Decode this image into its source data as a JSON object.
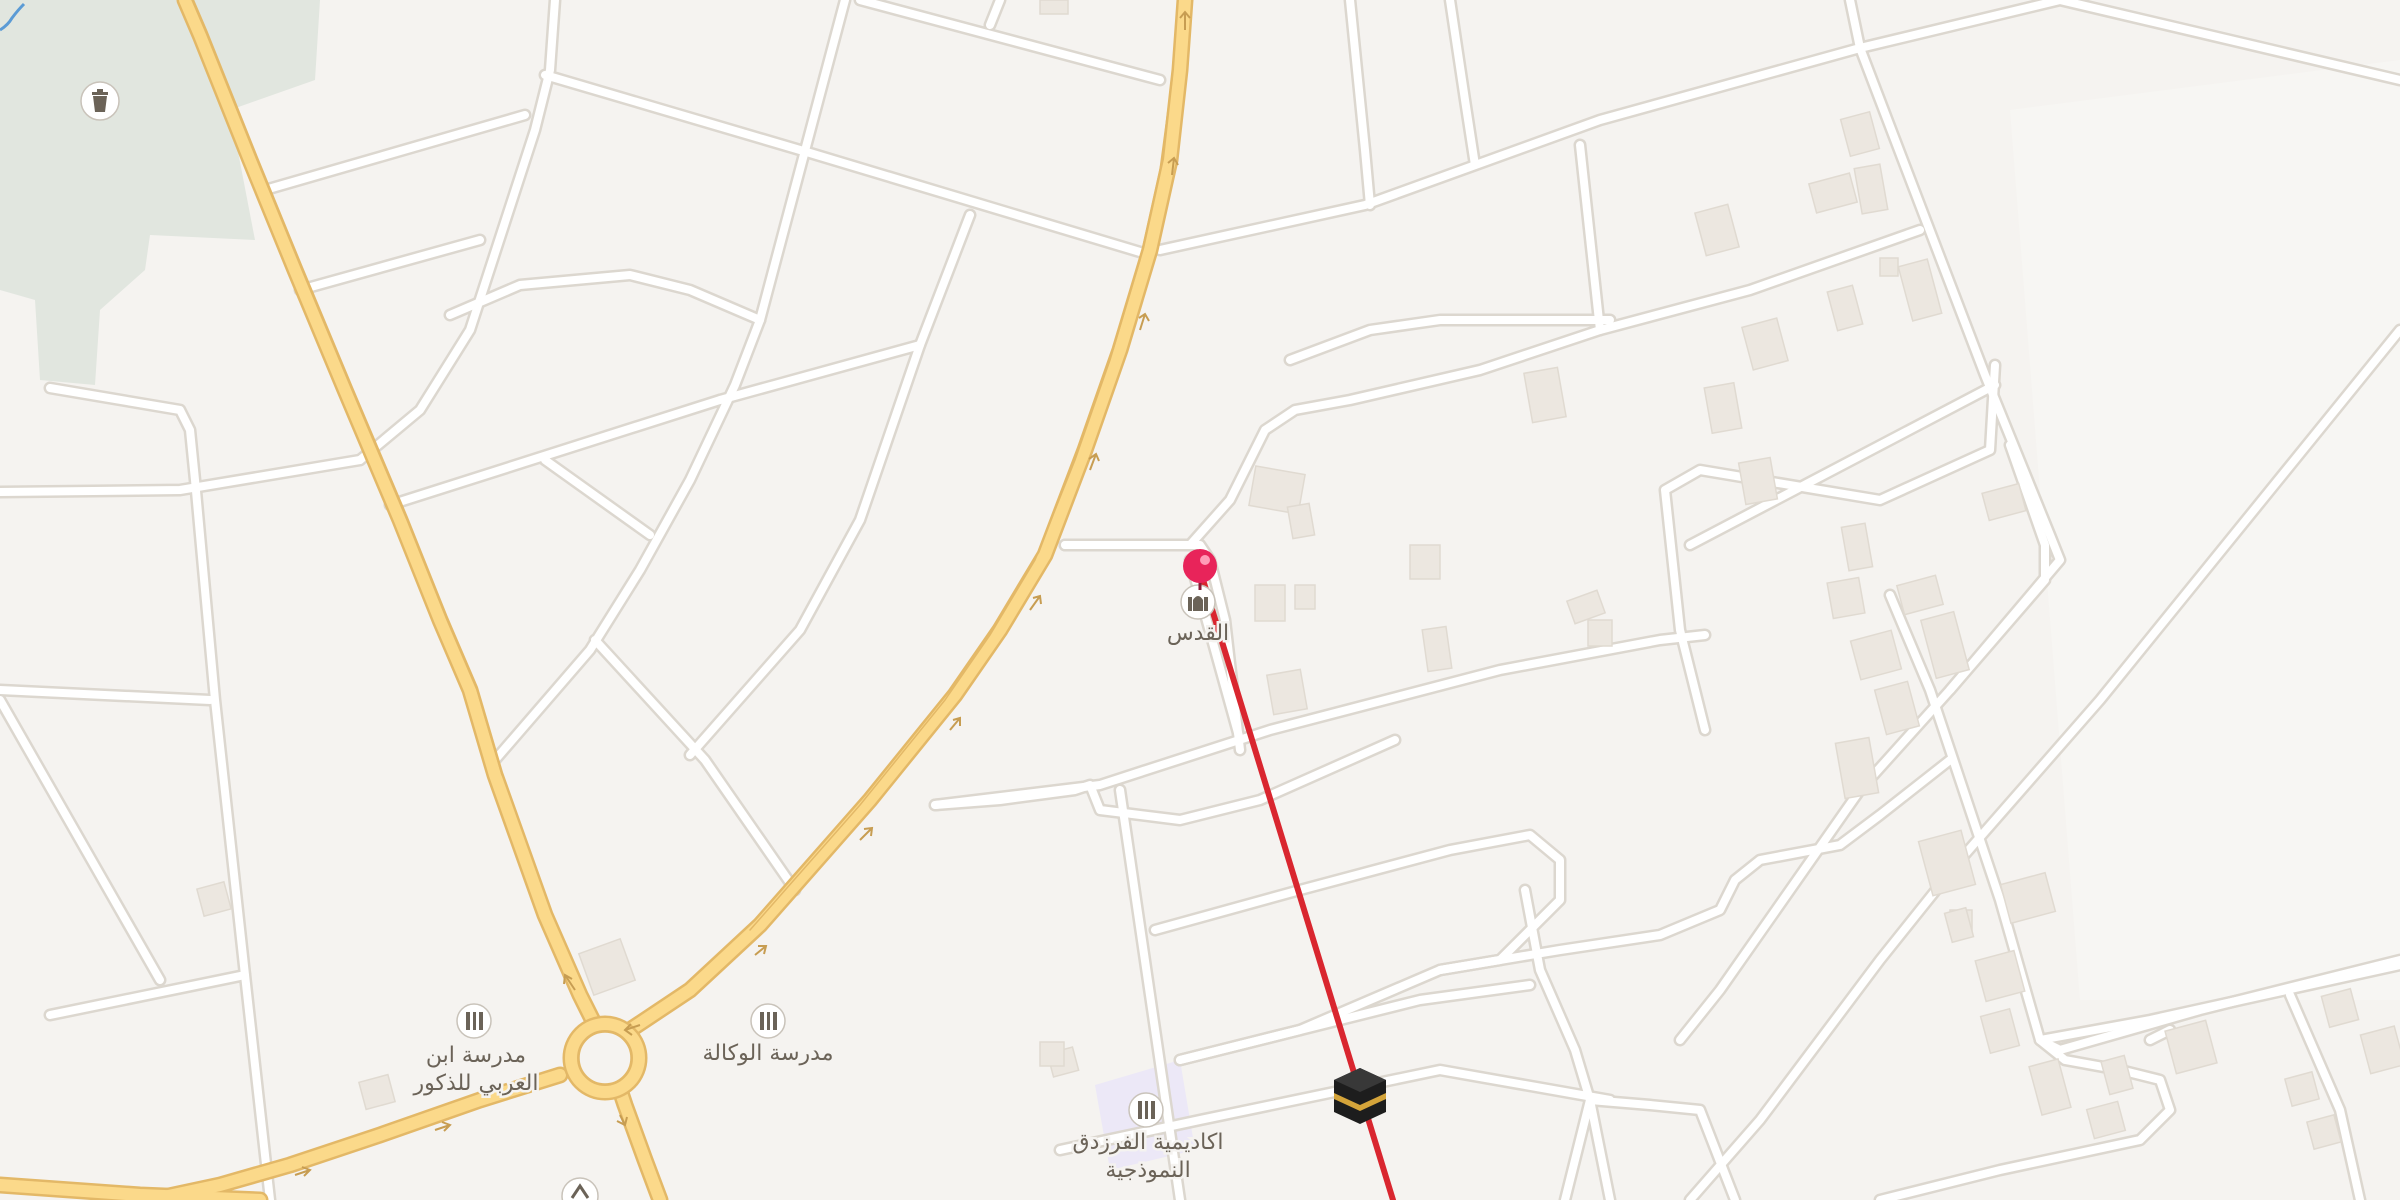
{
  "map": {
    "pois": [
      {
        "id": "mosque",
        "label": "القدس",
        "icon": "mosque-icon"
      },
      {
        "id": "school-ibn-arabi",
        "label": [
          "مدرسة ابن",
          "العربي للذكور"
        ],
        "icon": "school-icon"
      },
      {
        "id": "school-wakala",
        "label": "مدرسة الوكالة",
        "icon": "school-icon"
      },
      {
        "id": "academy",
        "label": [
          "اكاديمية الفرزدق",
          "النموذجية"
        ],
        "icon": "school-icon"
      },
      {
        "id": "park-pin",
        "label": "",
        "icon": "trash-icon"
      },
      {
        "id": "kaaba",
        "label": "",
        "icon": "kaaba-icon"
      }
    ],
    "route": {
      "label": "qibla-direction-line",
      "color": "#d9262f"
    },
    "marker": {
      "label": "current-location-pin",
      "color": "#e8245a"
    },
    "colors": {
      "land": "#f5f3f0",
      "road": "#ffffff",
      "road_casing": "#dcd7cf",
      "highway": "#fbd98a",
      "highway_casing": "#e3b867",
      "park": "#e1e6df",
      "building": "#ece7e0",
      "school_area": "#ece8f7"
    }
  }
}
